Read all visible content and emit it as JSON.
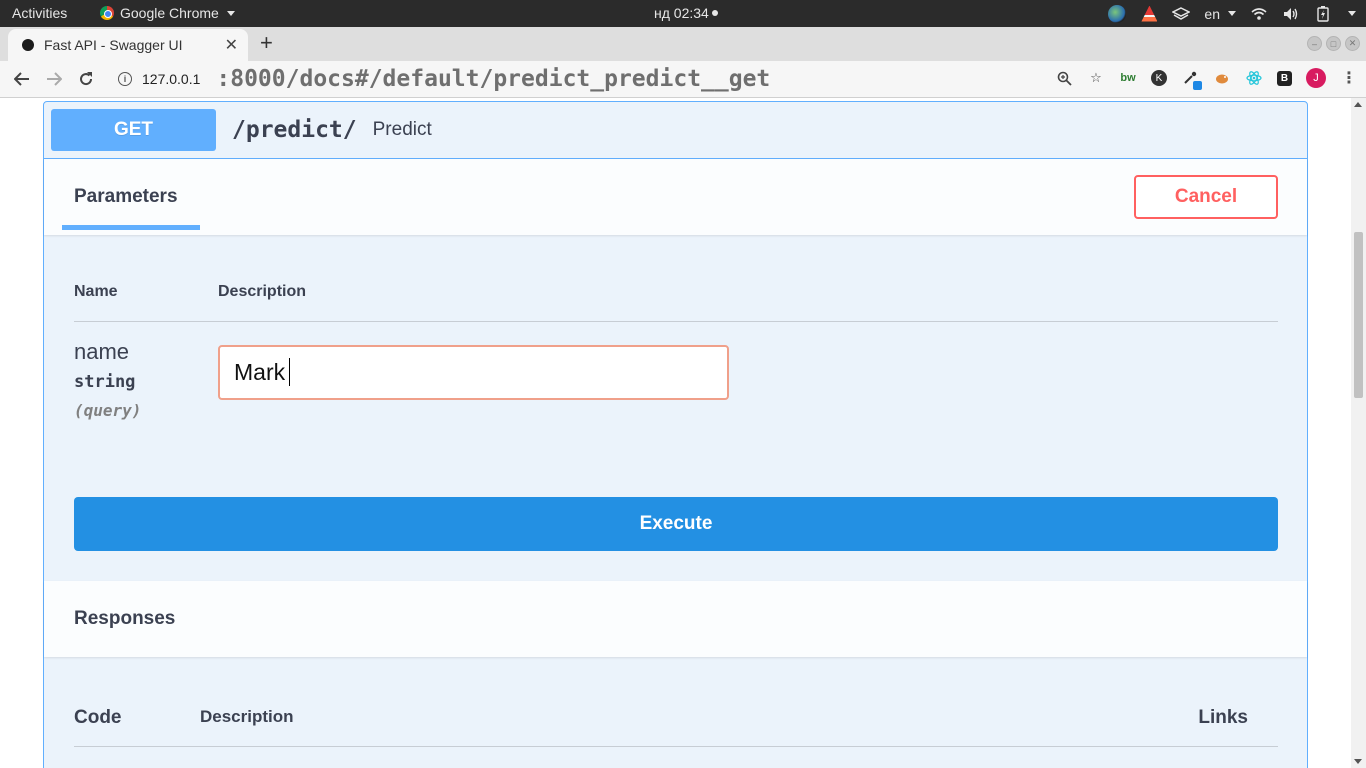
{
  "desktop": {
    "activities": "Activities",
    "app_name": "Google Chrome",
    "clock": "нд 02:34",
    "language": "en"
  },
  "browser": {
    "tab_title": "Fast API - Swagger UI",
    "url_host": "127.0.0.1",
    "url_rest": ":8000/docs#/default/predict_predict__get",
    "ext_bw": "bw",
    "ext_k": "K",
    "ext_b": "B",
    "avatar_letter": "J"
  },
  "operation": {
    "method": "GET",
    "path": "/predict/",
    "summary": "Predict",
    "parameters_title": "Parameters",
    "cancel_label": "Cancel",
    "col_name": "Name",
    "col_description": "Description",
    "param": {
      "name": "name",
      "type": "string",
      "in": "(query)",
      "value": "Mark"
    },
    "execute_label": "Execute",
    "responses_title": "Responses",
    "resp_col_code": "Code",
    "resp_col_description": "Description",
    "resp_col_links": "Links"
  },
  "colors": {
    "get_accent": "#61affe",
    "execute": "#2390e3",
    "cancel": "#ff6060",
    "opblock_bg": "#ebf3fb"
  }
}
